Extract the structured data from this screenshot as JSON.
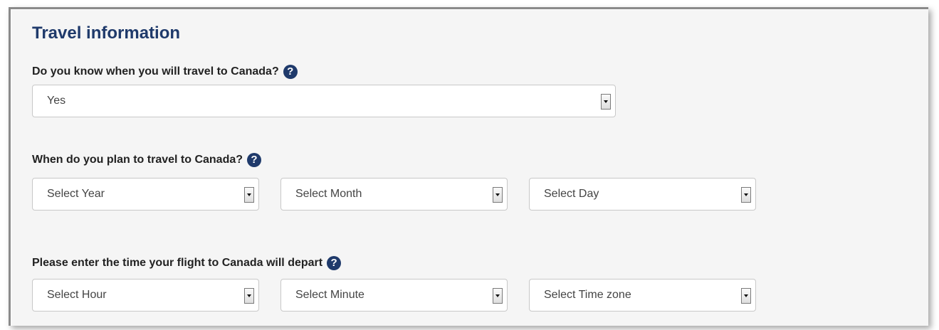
{
  "section": {
    "title": "Travel information"
  },
  "know_travel": {
    "question": "Do you know when you will travel to Canada?",
    "selected": "Yes"
  },
  "plan_travel": {
    "question": "When do you plan to travel to Canada?",
    "year": "Select Year",
    "month": "Select Month",
    "day": "Select Day"
  },
  "flight_time": {
    "question": "Please enter the time your flight to Canada will depart",
    "hour": "Select Hour",
    "minute": "Select Minute",
    "timezone": "Select Time zone"
  },
  "help_glyph": "?",
  "colors": {
    "heading": "#1f3a6b",
    "help_icon": "#1f3a6b"
  }
}
